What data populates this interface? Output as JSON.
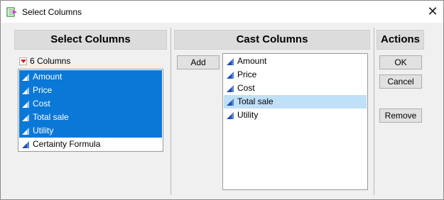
{
  "window": {
    "title": "Select Columns",
    "close_glyph": "✕"
  },
  "select_panel": {
    "header": "Select Columns",
    "count_label": "6 Columns",
    "items": [
      {
        "label": "Amount",
        "icon": "continuous-column-icon",
        "selected": true
      },
      {
        "label": "Price",
        "icon": "continuous-column-icon",
        "selected": true
      },
      {
        "label": "Cost",
        "icon": "continuous-column-icon",
        "selected": true
      },
      {
        "label": "Total sale",
        "icon": "continuous-column-icon",
        "selected": true
      },
      {
        "label": "Utility",
        "icon": "continuous-column-icon",
        "selected": true
      },
      {
        "label": "Certainty Formula",
        "icon": "continuous-column-icon",
        "selected": false
      }
    ]
  },
  "cast_panel": {
    "header": "Cast Columns",
    "add_button": "Add",
    "items": [
      {
        "label": "Amount",
        "icon": "continuous-column-icon",
        "highlighted": false
      },
      {
        "label": "Price",
        "icon": "continuous-column-icon",
        "highlighted": false
      },
      {
        "label": "Cost",
        "icon": "continuous-column-icon",
        "highlighted": false
      },
      {
        "label": "Total sale",
        "icon": "continuous-column-icon",
        "highlighted": true
      },
      {
        "label": "Utility",
        "icon": "continuous-column-icon",
        "highlighted": false
      }
    ]
  },
  "actions_panel": {
    "header": "Actions",
    "ok_button": "OK",
    "cancel_button": "Cancel",
    "remove_button": "Remove"
  },
  "colors": {
    "selection": "#0a78d7",
    "highlight": "#bfe0f7",
    "column_icon": "#1f4fb4",
    "dropdown_arrow": "#d21f1f"
  }
}
